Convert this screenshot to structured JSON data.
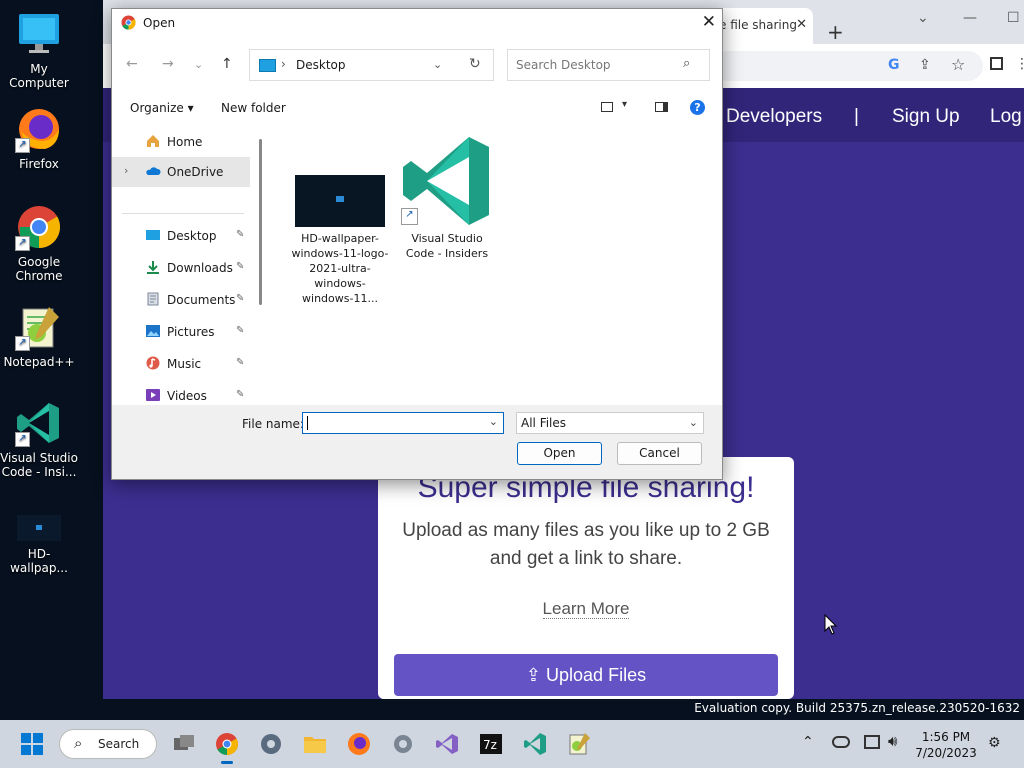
{
  "desktop": {
    "icons": [
      {
        "label": "My Computer"
      },
      {
        "label": "Firefox"
      },
      {
        "label": "Google Chrome"
      },
      {
        "label": "Notepad++"
      },
      {
        "label": "Visual Studio Code - Insi..."
      },
      {
        "label": "HD-wallpap..."
      }
    ],
    "eval_text": "Evaluation copy. Build 25375.zn_release.230520-1632"
  },
  "browser": {
    "tab_title": "e file sharing",
    "tab_close": "✕",
    "new_tab": "+",
    "nav_links": [
      "Developers",
      "|",
      "Sign Up",
      "Log"
    ],
    "hero_title": "Super simple file sharing!",
    "hero_subtitle": "Upload as many files as you like up to 2 GB and get a link to share.",
    "learn_more": "Learn More",
    "upload_button": "Upload Files"
  },
  "dialog": {
    "title": "Open",
    "close": "✕",
    "address": {
      "crumb": "Desktop"
    },
    "search_placeholder": "Search Desktop",
    "commands": {
      "organize": "Organize ▾",
      "new_folder": "New folder"
    },
    "nav_items": [
      {
        "label": "Home",
        "icon": "home-icon"
      },
      {
        "label": "OneDrive",
        "icon": "cloud-icon"
      },
      {
        "label": "Desktop",
        "icon": "desktop-icon"
      },
      {
        "label": "Downloads",
        "icon": "download-icon"
      },
      {
        "label": "Documents",
        "icon": "document-icon"
      },
      {
        "label": "Pictures",
        "icon": "picture-icon"
      },
      {
        "label": "Music",
        "icon": "music-icon"
      },
      {
        "label": "Videos",
        "icon": "video-icon"
      }
    ],
    "files": [
      {
        "name": "HD-wallpaper-windows-11-logo-2021-ultra-windows-windows-11..."
      },
      {
        "name": "Visual Studio Code - Insiders"
      }
    ],
    "file_name_label": "File name:",
    "file_name_value": "",
    "file_type": "All Files",
    "open_button": "Open",
    "cancel_button": "Cancel"
  },
  "taskbar": {
    "search_label": "Search",
    "time": "1:56 PM",
    "date": "7/20/2023"
  },
  "colors": {
    "site_bg": "#3b2e8f",
    "accent": "#0067c0",
    "upload": "#6353c4",
    "vscode": "#24bfa5"
  }
}
